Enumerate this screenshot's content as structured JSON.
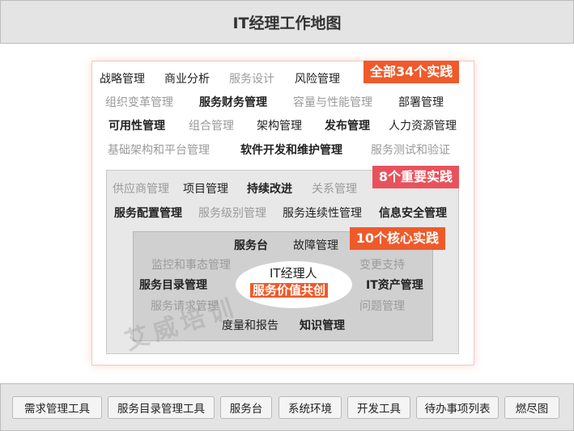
{
  "title": "IT经理工作地图",
  "tags": {
    "all": "全部34个实践",
    "important": "8个重要实践",
    "core": "10个核心实践"
  },
  "outer_rows": [
    [
      "战略管理",
      "商业分析",
      "服务设计",
      "风险管理"
    ],
    [
      "组织变革管理",
      "服务财务管理",
      "容量与性能管理",
      "部署管理"
    ],
    [
      "可用性管理",
      "组合管理",
      "架构管理",
      "发布管理",
      "人力资源管理"
    ],
    [
      "基础架构和平台管理",
      "软件开发和维护管理",
      "服务测试和验证"
    ]
  ],
  "middle_rows": [
    [
      "供应商管理",
      "项目管理",
      "持续改进",
      "关系管理"
    ],
    [
      "服务配置管理",
      "服务级别管理",
      "服务连续性管理",
      "信息安全管理"
    ]
  ],
  "core": {
    "items": [
      "服务台",
      "故障管理",
      "监控和事态管理",
      "变更支持",
      "服务目录管理",
      "IT资产管理",
      "服务请求管理",
      "问题管理",
      "度量和报告",
      "知识管理"
    ],
    "center_title": "IT经理人",
    "center_highlight": "服务价值共创"
  },
  "toolbar": [
    "需求管理工具",
    "服务目录管理工具",
    "服务台",
    "系统环境",
    "开发工具",
    "待办事项列表",
    "燃尽图"
  ],
  "watermark": "艾威培训",
  "colors": {
    "accent": "#ef5a2a",
    "important_tag": "#e8525c"
  }
}
